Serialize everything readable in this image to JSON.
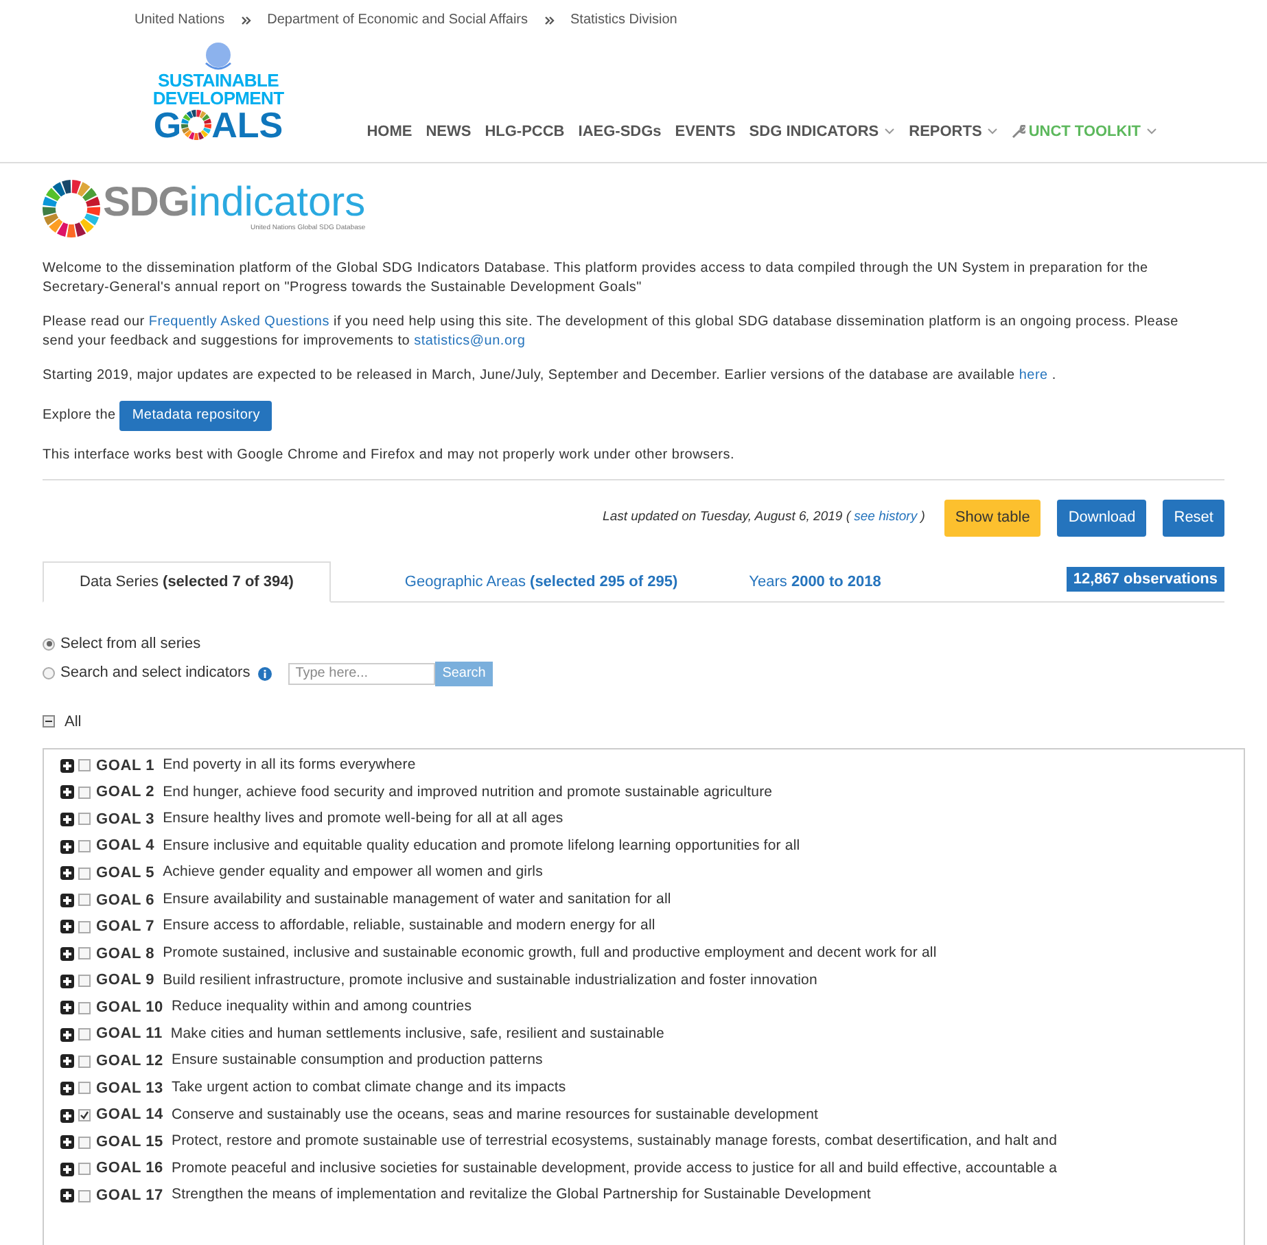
{
  "breadcrumb": [
    "United Nations",
    "Department of Economic and Social Affairs",
    "Statistics Division"
  ],
  "site_logo": {
    "lines": [
      "SUSTAINABLE",
      "DEVELOPMENT"
    ],
    "goals_before": "G",
    "goals_after": "ALS"
  },
  "nav": [
    {
      "label": "HOME",
      "has_menu": false,
      "color": "#555555",
      "icon": false
    },
    {
      "label": "NEWS",
      "has_menu": false,
      "color": "#555555",
      "icon": false
    },
    {
      "label": "HLG-PCCB",
      "has_menu": false,
      "color": "#555555",
      "icon": false
    },
    {
      "label": "IAEG-SDGs",
      "has_menu": false,
      "color": "#555555",
      "icon": false
    },
    {
      "label": "EVENTS",
      "has_menu": false,
      "color": "#555555",
      "icon": false
    },
    {
      "label": "SDG INDICATORS",
      "has_menu": true,
      "color": "#555555",
      "icon": false
    },
    {
      "label": "REPORTS",
      "has_menu": true,
      "color": "#555555",
      "icon": false
    },
    {
      "label": "UNCT TOOLKIT",
      "has_menu": true,
      "color": "#5cb85c",
      "icon": true
    }
  ],
  "sdg_logo": {
    "bold": "SDG",
    "light": "indicators",
    "subtitle": "United Nations Global SDG Database"
  },
  "paragraphs": [
    [
      {
        "kind": "text",
        "text": "Welcome to the dissemination platform of the Global SDG Indicators Database. This platform provides access to data compiled through the UN System in preparation for the Secretary-General's annual report on \"Progress towards the Sustainable Development Goals\""
      }
    ],
    [
      {
        "kind": "text",
        "text": "Please read our "
      },
      {
        "kind": "link",
        "text": "Frequently Asked Questions"
      },
      {
        "kind": "text",
        "text": " if you need help using this site. The development of this global SDG database dissemination platform is an ongoing process. Please send your feedback and suggestions for improvements to "
      },
      {
        "kind": "link",
        "text": "statistics@un.org"
      }
    ],
    [
      {
        "kind": "text",
        "text": "Starting 2019, major updates are expected to be released in March, June/July, September and December. Earlier versions of the database are available "
      },
      {
        "kind": "link",
        "text": "here"
      },
      {
        "kind": "text",
        "text": " ."
      }
    ]
  ],
  "metadata": {
    "label": "Explore the",
    "button": "Metadata repository"
  },
  "browser_note": "This interface works best with Google Chrome and Firefox and may not properly work under other browsers.",
  "update": {
    "text": "Last updated on Tuesday, August 6, 2019 (",
    "link": "see history",
    "close": ")"
  },
  "actions": [
    {
      "label": "Show table",
      "color": "#fcc02e"
    },
    {
      "label": "Download",
      "color": "#2574bd"
    },
    {
      "label": "Reset",
      "color": "#2574bd"
    }
  ],
  "tabs": [
    {
      "label": "Data Series **(selected 7 of 394)**",
      "selected": true
    },
    {
      "label": "Geographic Areas **(selected 295 of 295)**",
      "selected": false
    },
    {
      "label": "Years **2000 to 2018**",
      "selected": false
    }
  ],
  "observations": "12,867 observations",
  "modes": [
    {
      "label": "Select from all series",
      "selected": true
    },
    {
      "label": "Search and select indicators",
      "selected": false
    }
  ],
  "search": {
    "placeholder": "Type here...",
    "button": "Search"
  },
  "all": {
    "label": "All",
    "expanded": true
  },
  "goals": [
    {
      "code": "GOAL 1",
      "text": "End poverty in all its forms everywhere",
      "checked": false,
      "expanded": false
    },
    {
      "code": "GOAL 2",
      "text": "End hunger, achieve food security and improved nutrition and promote sustainable agriculture",
      "checked": false,
      "expanded": false
    },
    {
      "code": "GOAL 3",
      "text": "Ensure healthy lives and promote well-being for all at all ages",
      "checked": false,
      "expanded": false
    },
    {
      "code": "GOAL 4",
      "text": "Ensure inclusive and equitable quality education and promote lifelong learning opportunities for all",
      "checked": false,
      "expanded": false
    },
    {
      "code": "GOAL 5",
      "text": "Achieve gender equality and empower all women and girls",
      "checked": false,
      "expanded": false
    },
    {
      "code": "GOAL 6",
      "text": "Ensure availability and sustainable management of water and sanitation for all",
      "checked": false,
      "expanded": false
    },
    {
      "code": "GOAL 7",
      "text": "Ensure access to affordable, reliable, sustainable and modern energy for all",
      "checked": false,
      "expanded": false
    },
    {
      "code": "GOAL 8",
      "text": "Promote sustained, inclusive and sustainable economic growth, full and productive employment and decent work for all",
      "checked": false,
      "expanded": false
    },
    {
      "code": "GOAL 9",
      "text": "Build resilient infrastructure, promote inclusive and sustainable industrialization and foster innovation",
      "checked": false,
      "expanded": false
    },
    {
      "code": "GOAL 10",
      "text": "Reduce inequality within and among countries",
      "checked": false,
      "expanded": false
    },
    {
      "code": "GOAL 11",
      "text": "Make cities and human settlements inclusive, safe, resilient and sustainable",
      "checked": false,
      "expanded": false
    },
    {
      "code": "GOAL 12",
      "text": "Ensure sustainable consumption and production patterns",
      "checked": false,
      "expanded": false
    },
    {
      "code": "GOAL 13",
      "text": "Take urgent action to combat climate change and its impacts",
      "checked": false,
      "expanded": false
    },
    {
      "code": "GOAL 14",
      "text": "Conserve and sustainably use the oceans, seas and marine resources for sustainable development",
      "checked": true,
      "expanded": false
    },
    {
      "code": "GOAL 15",
      "text": "Protect, restore and promote sustainable use of terrestrial ecosystems, sustainably manage forests, combat desertification, and halt and",
      "checked": false,
      "expanded": false
    },
    {
      "code": "GOAL 16",
      "text": "Promote peaceful and inclusive societies for sustainable development, provide access to justice for all and build effective, accountable a",
      "checked": false,
      "expanded": false
    },
    {
      "code": "GOAL 17",
      "text": "Strengthen the means of implementation and revitalize the Global Partnership for Sustainable Development",
      "checked": false,
      "expanded": false
    }
  ]
}
